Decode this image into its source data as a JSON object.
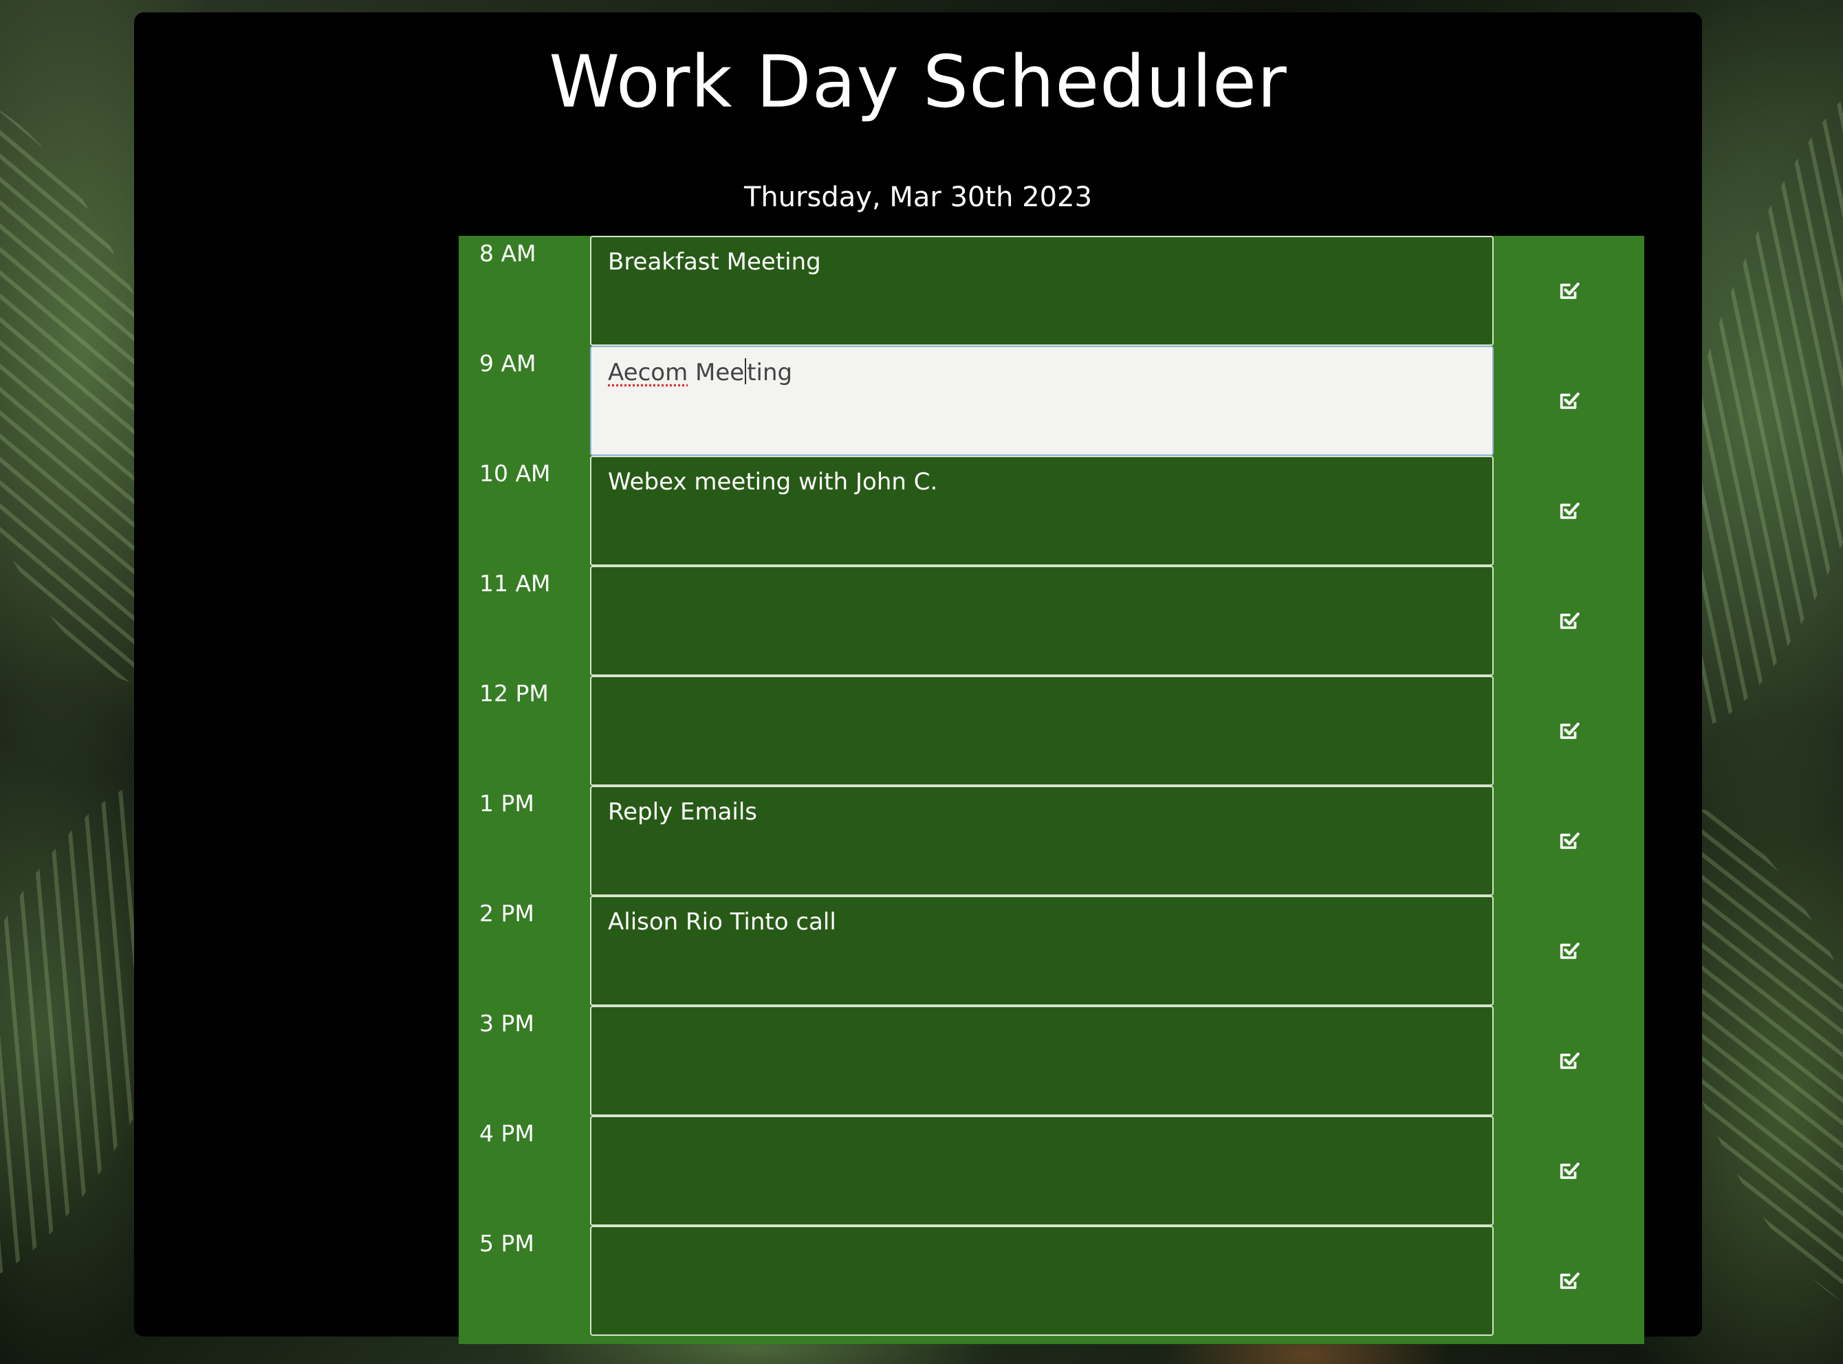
{
  "page": {
    "title": "Work Day Scheduler",
    "date": "Thursday, Mar 30th 2023"
  },
  "colors": {
    "panel": "#000000",
    "timeblock_green": "#367d24",
    "entry_green": "#285a17",
    "active_entry": "#f3f3f1",
    "text": "#ffffff"
  },
  "schedule": {
    "rows": [
      {
        "hour": "8 AM",
        "text": "Breakfast Meeting",
        "save_icon": "check-square-icon"
      },
      {
        "hour": "9 AM",
        "text_parts": [
          "Aecom",
          " Mee",
          "ting"
        ],
        "active": true,
        "save_icon": "check-square-icon"
      },
      {
        "hour": "10 AM",
        "text": "Webex meeting with John C.",
        "save_icon": "check-square-icon"
      },
      {
        "hour": "11 AM",
        "text": "",
        "save_icon": "check-square-icon"
      },
      {
        "hour": "12 PM",
        "text": "",
        "save_icon": "check-square-icon"
      },
      {
        "hour": "1 PM",
        "text": "Reply Emails",
        "save_icon": "check-square-icon"
      },
      {
        "hour": "2 PM",
        "text": "Alison Rio Tinto call",
        "save_icon": "check-square-icon"
      },
      {
        "hour": "3 PM",
        "text": "",
        "save_icon": "check-square-icon"
      },
      {
        "hour": "4 PM",
        "text": "",
        "save_icon": "check-square-icon"
      },
      {
        "hour": "5 PM",
        "text": "",
        "save_icon": "check-square-icon"
      }
    ]
  }
}
